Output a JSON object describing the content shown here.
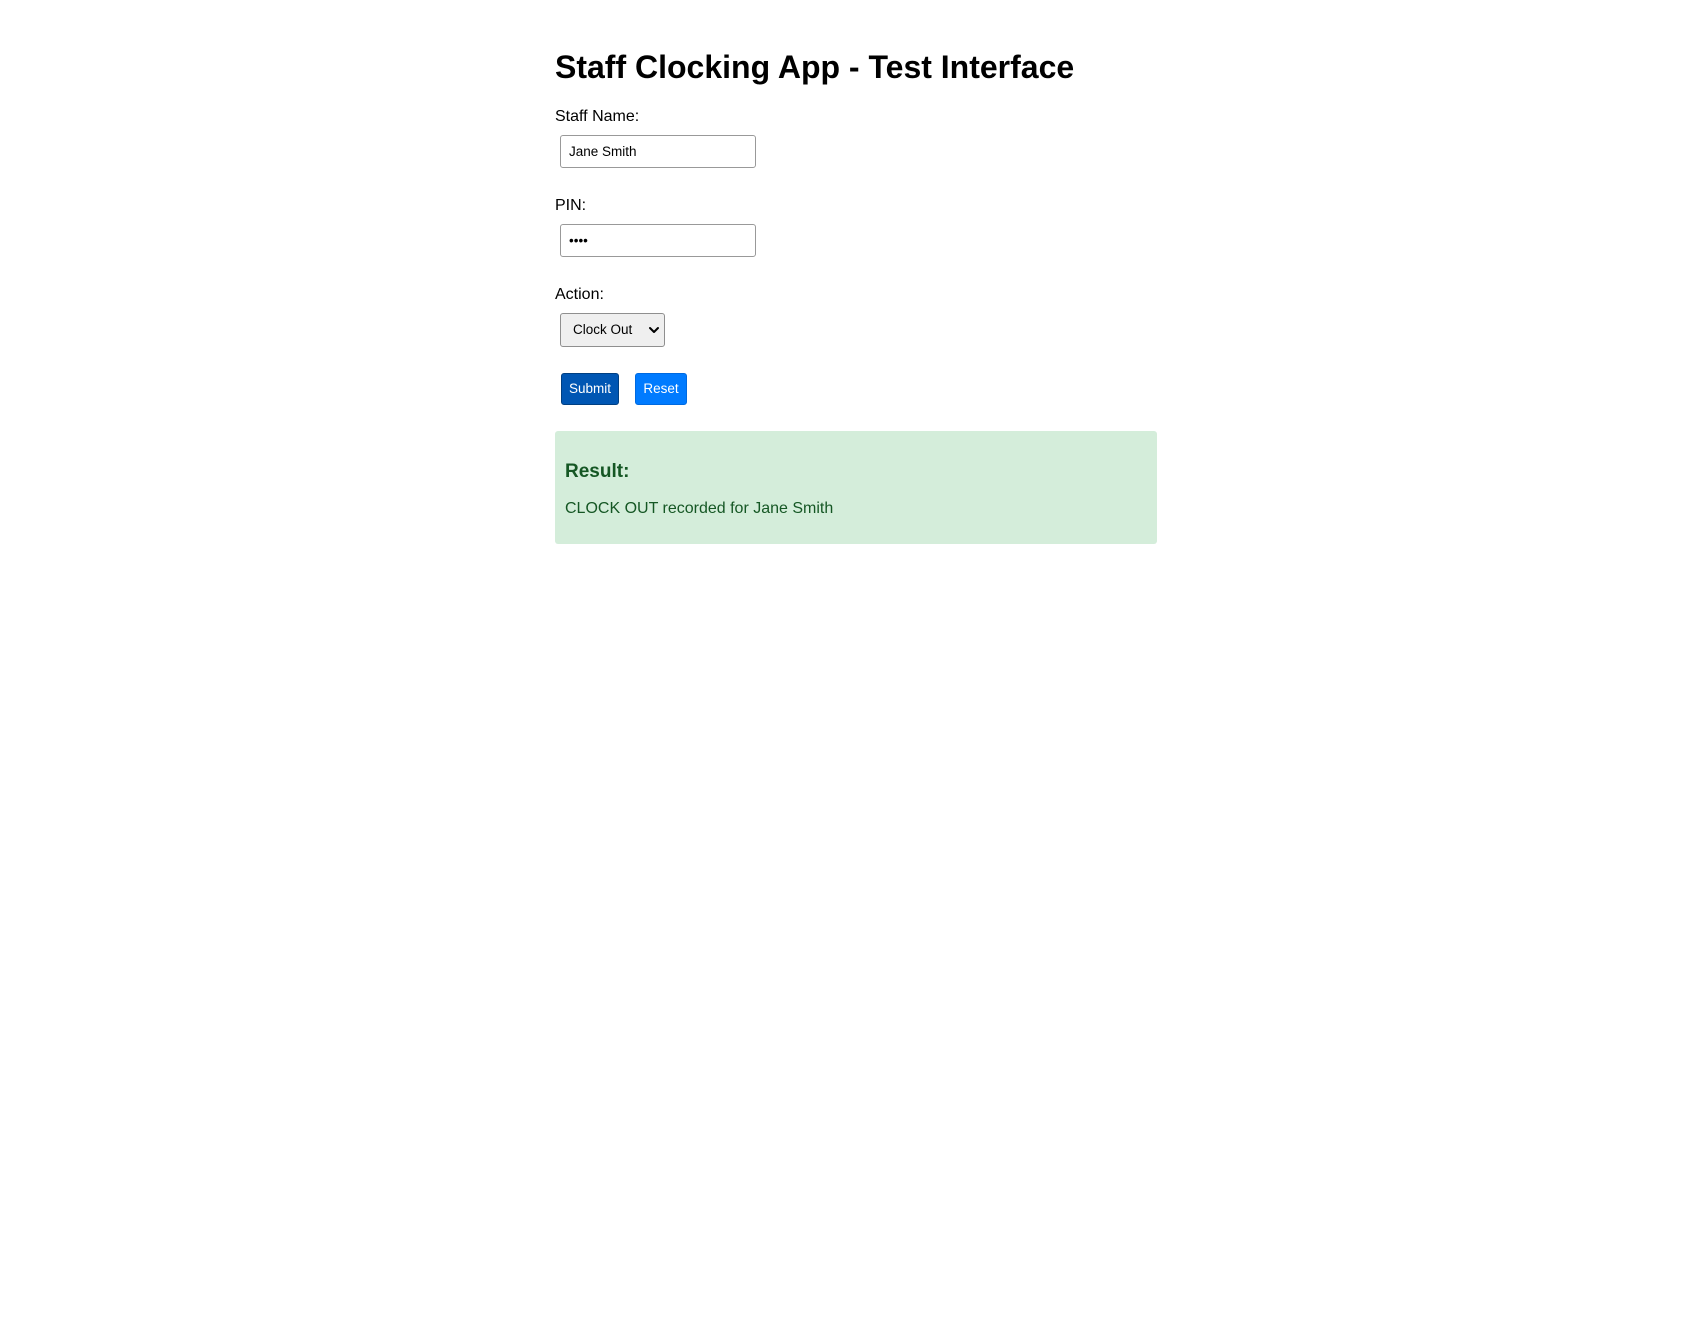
{
  "page": {
    "title": "Staff Clocking App - Test Interface"
  },
  "form": {
    "staff_name": {
      "label": "Staff Name:",
      "value": "Jane Smith"
    },
    "pin": {
      "label": "PIN:",
      "value": "••••"
    },
    "action": {
      "label": "Action:",
      "selected": "Clock Out",
      "icon": "chevron-down-icon"
    },
    "submit_label": "Submit",
    "reset_label": "Reset"
  },
  "result": {
    "heading": "Result:",
    "message": "CLOCK OUT recorded for Jane Smith"
  },
  "colors": {
    "submit_bg": "#0056b3",
    "reset_bg": "#007bff",
    "result_bg": "#d4edda",
    "result_text": "#155724"
  }
}
